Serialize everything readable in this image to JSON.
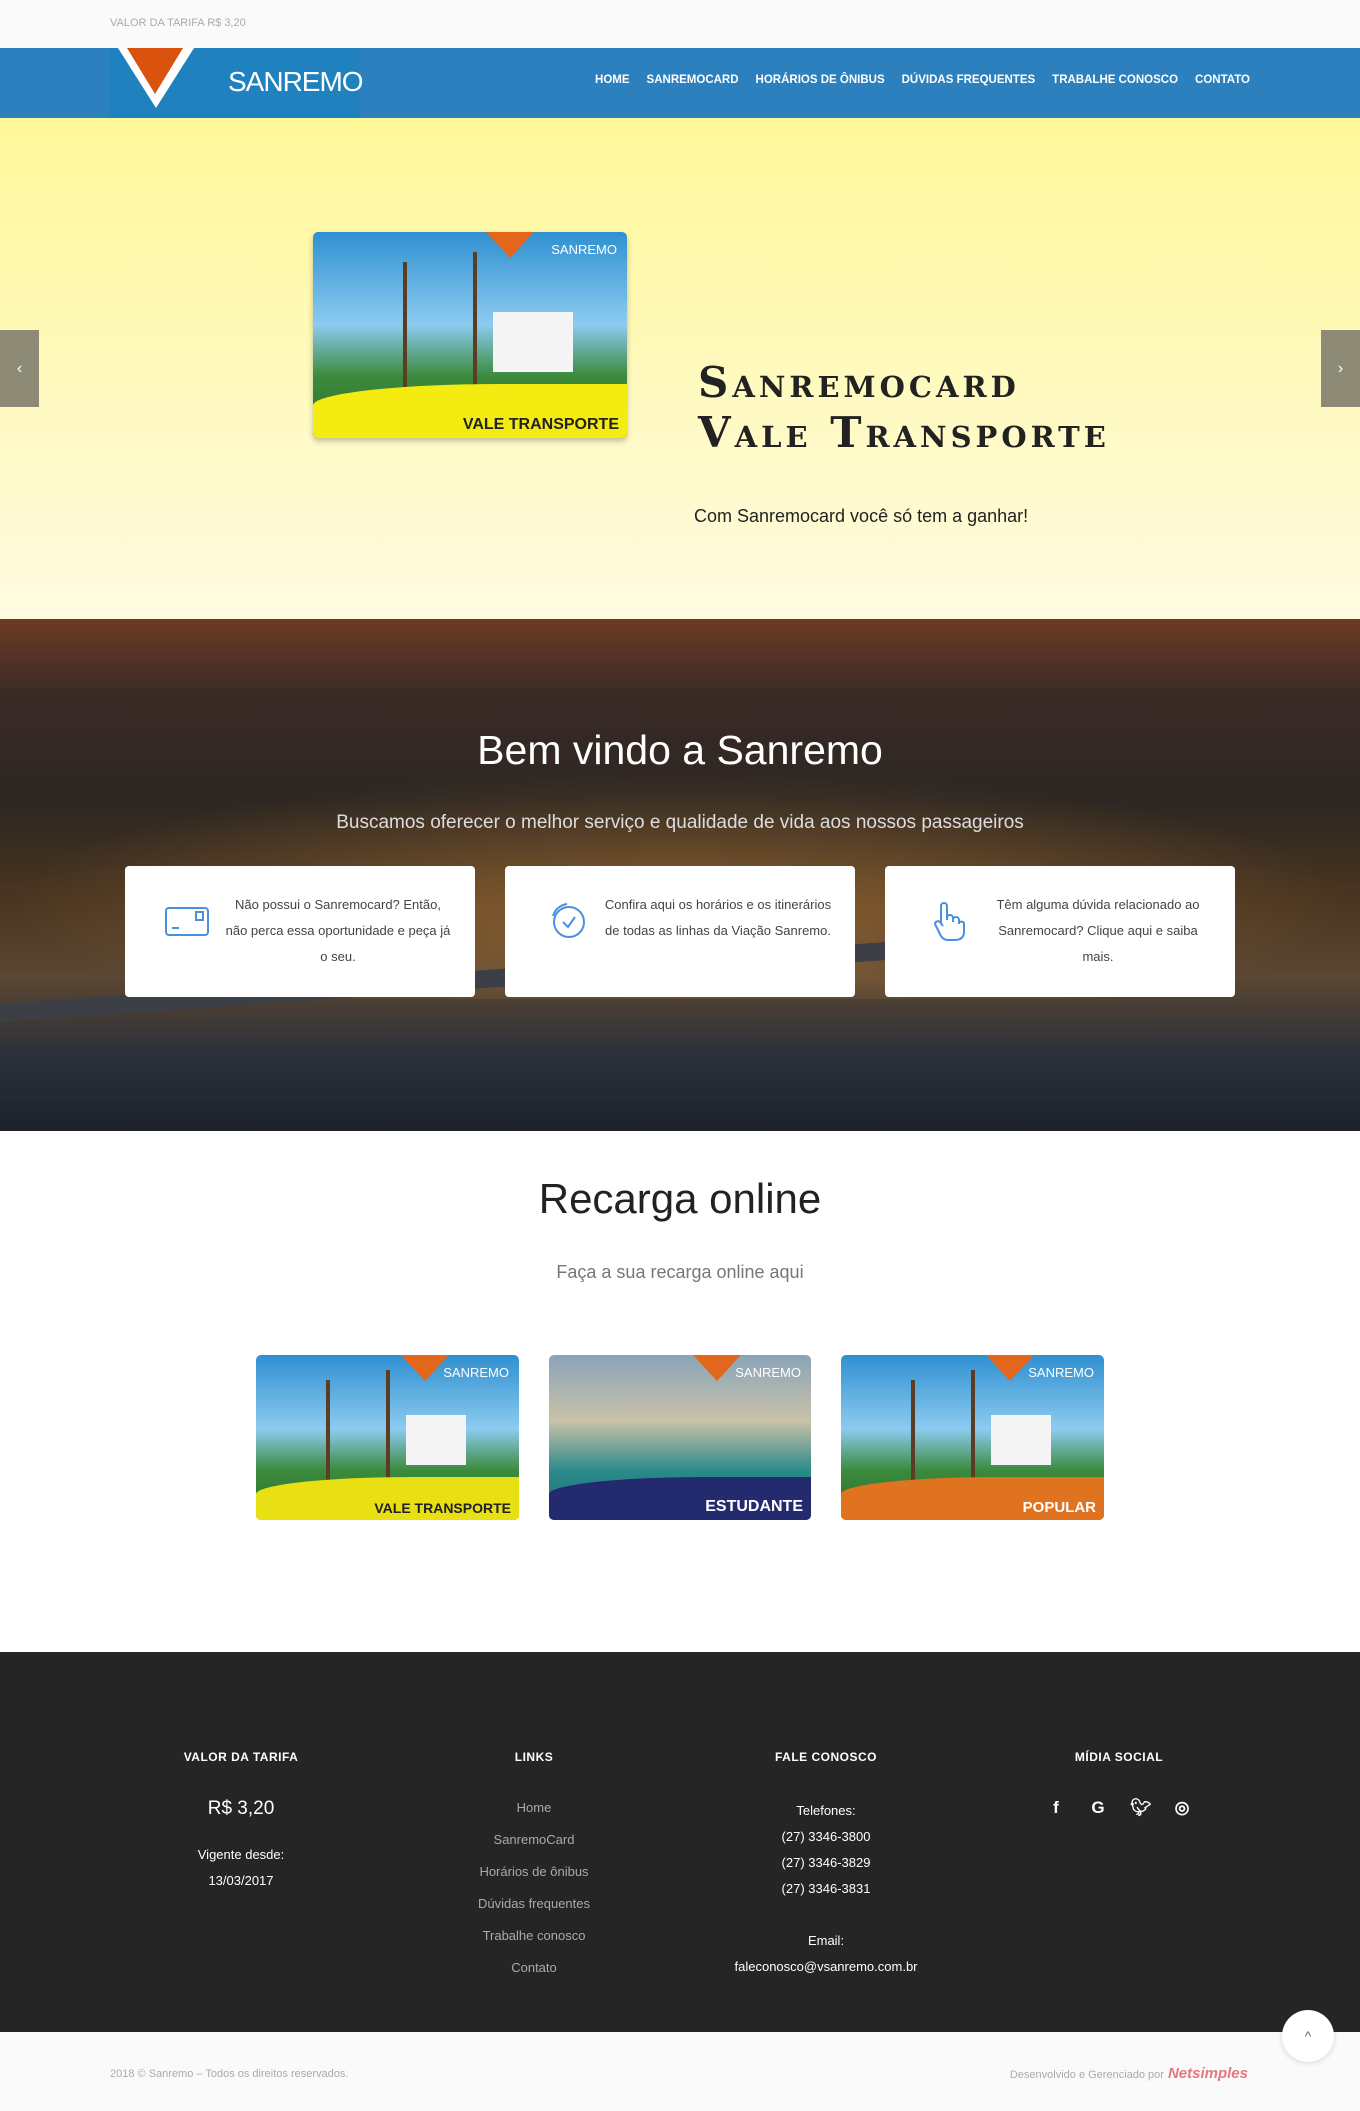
{
  "topbar": {
    "tariff": "VALOR DA TARIFA R$ 3,20"
  },
  "brand": {
    "logo_text": "SANREMO"
  },
  "nav": {
    "items": [
      "HOME",
      "SANREMOCARD",
      "HORÁRIOS DE ÔNIBUS",
      "DÚVIDAS FREQUENTES",
      "TRABALHE CONOSCO",
      "CONTATO"
    ]
  },
  "slider": {
    "title_line1": "Sanremocard",
    "title_line2": "Vale Transporte",
    "subtitle": "Com Sanremocard você só tem a ganhar!",
    "card_brand": "SANREMO",
    "card_label": "VALE TRANSPORTE",
    "prev": "‹",
    "next": "›"
  },
  "welcome": {
    "title": "Bem vindo a Sanremo",
    "subtitle": "Buscamos oferecer o melhor serviço e qualidade de vida aos nossos passageiros",
    "boxes": [
      {
        "icon": "card-icon",
        "text": "Não possui o Sanremocard? Então, não perca essa oportunidade e peça já o seu."
      },
      {
        "icon": "clock-icon",
        "text": "Confira aqui os horários e os itinerários de todas as linhas da Viação Sanremo."
      },
      {
        "icon": "hand-pointer-icon",
        "text": "Têm alguma dúvida relacionado ao Sanremocard? Clique aqui e saiba mais."
      }
    ]
  },
  "recarga": {
    "title": "Recarga online",
    "subtitle": "Faça a sua recarga online aqui",
    "cards": [
      {
        "brand": "SANREMO",
        "label": "VALE TRANSPORTE",
        "color": "#e8e012"
      },
      {
        "brand": "SANREMO",
        "label": "ESTUDANTE",
        "color": "#232a6e"
      },
      {
        "brand": "SANREMO",
        "label": "POPULAR",
        "color": "#e07320"
      }
    ]
  },
  "footer": {
    "tarifa": {
      "heading": "VALOR DA TARIFA",
      "value": "R$ 3,20",
      "since_label": "Vigente desde:",
      "since_date": "13/03/2017"
    },
    "links": {
      "heading": "LINKS",
      "items": [
        "Home",
        "SanremoCard",
        "Horários de ônibus",
        "Dúvidas frequentes",
        "Trabalhe conosco",
        "Contato"
      ]
    },
    "contato": {
      "heading": "FALE CONOSCO",
      "phones_label": "Telefones:",
      "phones": [
        "(27) 3346-3800",
        "(27) 3346-3829",
        "(27) 3346-3831"
      ],
      "email_label": "Email:",
      "email": "faleconosco@vsanremo.com.br"
    },
    "social": {
      "heading": "MÍDIA SOCIAL",
      "icons": [
        "f",
        "G",
        "t",
        "◎"
      ]
    }
  },
  "bottom": {
    "copyright": "2018 © Sanremo – Todos os direitos reservados.",
    "dev": "Desenvolvido e Gerenciado por",
    "dev_brand": "Netsimples"
  },
  "totop": "^",
  "colors": {
    "nav": "#2b80bd",
    "footer": "#252525",
    "accent": "#d9530f"
  }
}
